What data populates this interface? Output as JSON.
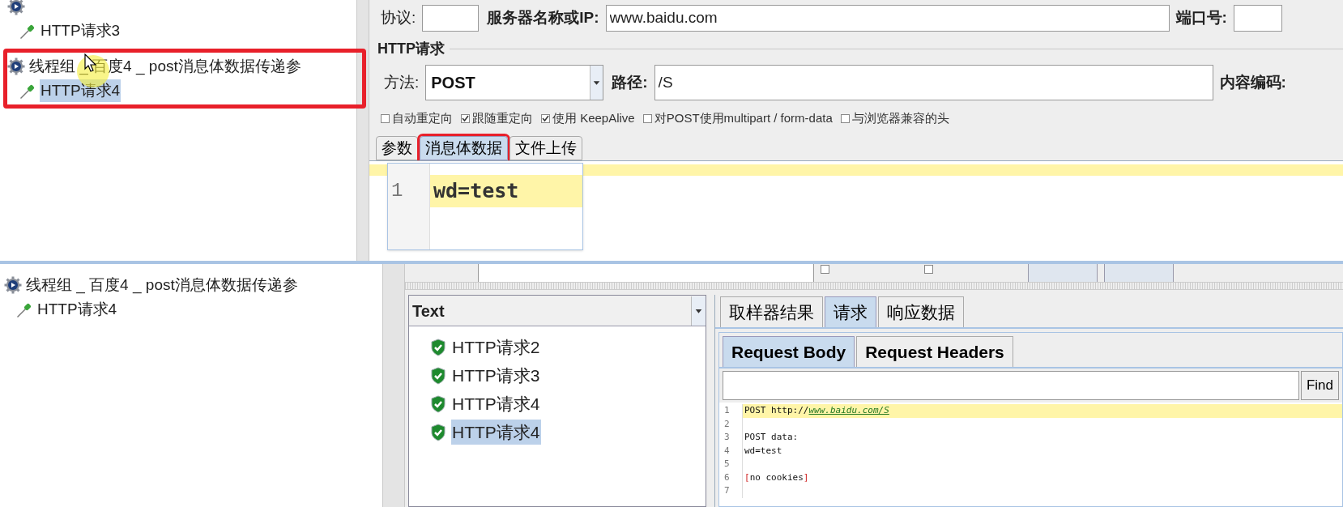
{
  "top": {
    "tree": [
      {
        "kind": "group",
        "outlined": false,
        "children": [
          {
            "label": "HTTP请求3",
            "kind": "request",
            "selected": false
          }
        ]
      },
      {
        "label": "线程组 _ 百度4 _ post消息体数据传递参",
        "kind": "group",
        "selected": false,
        "outlined": true,
        "children": [
          {
            "label": "HTTP请求4",
            "kind": "request",
            "selected": true
          }
        ]
      }
    ],
    "protocol": {
      "label": "协议:"
    },
    "server": {
      "label": "服务器名称或IP:",
      "value": "www.baidu.com"
    },
    "port": {
      "label": "端口号:"
    },
    "http_request": {
      "title": "HTTP请求",
      "method": {
        "label": "方法:",
        "value": "POST"
      },
      "path": {
        "label": "路径:",
        "value": "/S"
      },
      "encoding": {
        "label": "内容编码:"
      },
      "options": [
        {
          "label": "自动重定向",
          "checked": false
        },
        {
          "label": "跟随重定向",
          "checked": true
        },
        {
          "label": "使用 KeepAlive",
          "checked": true
        },
        {
          "label": "对POST使用multipart / form-data",
          "checked": false
        },
        {
          "label": "与浏览器兼容的头",
          "checked": false
        }
      ],
      "tabs": [
        {
          "label": "参数",
          "selected": false,
          "outlined": false
        },
        {
          "label": "消息体数据",
          "selected": true,
          "outlined": true
        },
        {
          "label": "文件上传",
          "selected": false,
          "outlined": false
        }
      ],
      "body_lines": [
        {
          "number": "1",
          "text": "wd=test"
        }
      ]
    }
  },
  "bottom": {
    "tree": [
      {
        "label": "线程组 _ 百度4 _ post消息体数据传递参",
        "kind": "group",
        "selected": false,
        "children": [
          {
            "label": "HTTP请求4",
            "kind": "request",
            "selected": false
          }
        ]
      }
    ],
    "search": {
      "options": [
        {
          "checked": false
        },
        {
          "checked": false
        }
      ],
      "buttons": [
        {
          "kind": "button"
        },
        {
          "kind": "button"
        }
      ]
    },
    "renderer": {
      "value": "Text"
    },
    "results": [
      {
        "label": "HTTP请求2",
        "selected": false
      },
      {
        "label": "HTTP请求3",
        "selected": false
      },
      {
        "label": "HTTP请求4",
        "selected": false
      },
      {
        "label": "HTTP请求4",
        "selected": true
      }
    ],
    "tabs": [
      {
        "label": "取样器结果",
        "selected": false
      },
      {
        "label": "请求",
        "selected": true
      },
      {
        "label": "响应数据",
        "selected": false
      }
    ],
    "subtabs": [
      {
        "label": "Request Body",
        "selected": true
      },
      {
        "label": "Request Headers",
        "selected": false
      }
    ],
    "find_button": "Find",
    "lines": [
      {
        "number": "1",
        "kind": "request",
        "text": "POST http://",
        "link": "www.baidu.com/S",
        "current": true
      },
      {
        "number": "2",
        "kind": "plain",
        "current": false
      },
      {
        "number": "3",
        "kind": "plain",
        "text": "POST data:",
        "current": false
      },
      {
        "number": "4",
        "kind": "plain",
        "text": "wd=test",
        "current": false
      },
      {
        "number": "5",
        "kind": "plain",
        "current": false
      },
      {
        "number": "6",
        "kind": "note",
        "open": "[",
        "text": "no cookies",
        "close": "]",
        "current": false
      },
      {
        "number": "7",
        "kind": "plain",
        "current": false
      }
    ]
  }
}
